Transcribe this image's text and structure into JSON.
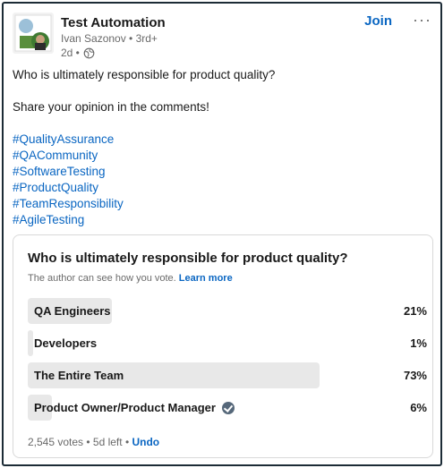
{
  "post": {
    "author": {
      "name": "Test Automation",
      "subtitle": "Ivan Sazonov • 3rd+",
      "time": "2d •"
    },
    "join_label": "Join",
    "more_label": "···",
    "text_line1": "Who is ultimately responsible for product quality?",
    "text_line2": "Share your opinion in the comments!",
    "hashtags": [
      "#QualityAssurance",
      "#QACommunity",
      "#SoftwareTesting",
      "#ProductQuality",
      "#TeamResponsibility",
      "#AgileTesting"
    ]
  },
  "poll": {
    "question": "Who is ultimately responsible for product quality?",
    "note": "The author can see how you vote.",
    "learn_more": "Learn more",
    "options": [
      {
        "label": "QA Engineers",
        "percent_label": "21%",
        "percent": 21,
        "selected": false
      },
      {
        "label": "Developers",
        "percent_label": "1%",
        "percent": 1,
        "selected": false
      },
      {
        "label": "The Entire Team",
        "percent_label": "73%",
        "percent": 73,
        "selected": false
      },
      {
        "label": "Product Owner/Product Manager",
        "percent_label": "6%",
        "percent": 6,
        "selected": true
      }
    ],
    "footer": "2,545 votes • 5d left •",
    "undo_label": "Undo"
  },
  "colors": {
    "link": "#0a66c2",
    "bar": "#e8e8e8",
    "border": "#1c2b36"
  }
}
